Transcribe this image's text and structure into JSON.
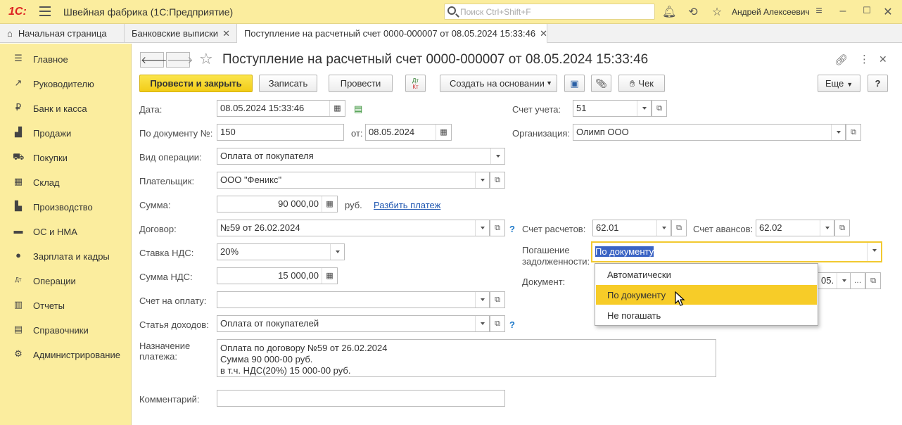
{
  "topbar": {
    "logo": "1С:",
    "app_title": "Швейная фабрика  (1С:Предприятие)",
    "search_placeholder": "Поиск Ctrl+Shift+F",
    "user": "Андрей Алексеевич"
  },
  "tabs": [
    {
      "label": "Начальная страница"
    },
    {
      "label": "Банковские выписки"
    },
    {
      "label": "Поступление на расчетный счет 0000-000007 от 08.05.2024 15:33:46"
    }
  ],
  "sidebar": {
    "items": [
      {
        "label": "Главное"
      },
      {
        "label": "Руководителю"
      },
      {
        "label": "Банк и касса"
      },
      {
        "label": "Продажи"
      },
      {
        "label": "Покупки"
      },
      {
        "label": "Склад"
      },
      {
        "label": "Производство"
      },
      {
        "label": "ОС и НМА"
      },
      {
        "label": "Зарплата и кадры"
      },
      {
        "label": "Операции"
      },
      {
        "label": "Отчеты"
      },
      {
        "label": "Справочники"
      },
      {
        "label": "Администрирование"
      }
    ]
  },
  "doc": {
    "title": "Поступление на расчетный счет 0000-000007 от 08.05.2024 15:33:46"
  },
  "toolbar": {
    "post_close": "Провести и закрыть",
    "save": "Записать",
    "post": "Провести",
    "dtkt_top": "Дт",
    "dtkt_bottom": "Кт",
    "create_based": "Создать на основании",
    "receipt": "Чек",
    "more": "Еще",
    "help": "?"
  },
  "form": {
    "date_label": "Дата:",
    "date_value": "08.05.2024 15:33:46",
    "docnum_label": "По документу №:",
    "docnum_value": "150",
    "from_label": "от:",
    "from_value": "08.05.2024",
    "optype_label": "Вид операции:",
    "optype_value": "Оплата от покупателя",
    "payer_label": "Плательщик:",
    "payer_value": "ООО \"Феникс\"",
    "sum_label": "Сумма:",
    "sum_value": "90 000,00",
    "currency": "руб.",
    "split_link": "Разбить платеж",
    "contract_label": "Договор:",
    "contract_value": "№59 от 26.02.2024",
    "vat_rate_label": "Ставка НДС:",
    "vat_rate_value": "20%",
    "vat_sum_label": "Сумма НДС:",
    "vat_sum_value": "15 000,00",
    "invoice_label": "Счет на оплату:",
    "invoice_value": "",
    "income_label": "Статья доходов:",
    "income_value": "Оплата от покупателей",
    "purpose_label_1": "Назначение",
    "purpose_label_2": "платежа:",
    "purpose_line1": "Оплата по договору №59 от 26.02.2024",
    "purpose_line2": "Сумма 90 000-00 руб.",
    "purpose_line3": "в т.ч. НДС(20%) 15 000-00 руб.",
    "comment_label": "Комментарий:",
    "comment_value": "",
    "account_label": "Счет учета:",
    "account_value": "51",
    "org_label": "Организация:",
    "org_value": "Олимп ООО",
    "settle_label": "Счет расчетов:",
    "settle_value": "62.01",
    "adv_label": "Счет авансов:",
    "adv_value": "62.02",
    "repay_label_1": "Погашение",
    "repay_label_2": "задолженности:",
    "repay_value": "По документу",
    "document_label": "Документ:",
    "document_value": "05.",
    "q": "?"
  },
  "popup": {
    "items": [
      {
        "label": "Автоматически"
      },
      {
        "label": "По документу"
      },
      {
        "label": "Не погашать"
      }
    ],
    "selected_index": 1
  }
}
